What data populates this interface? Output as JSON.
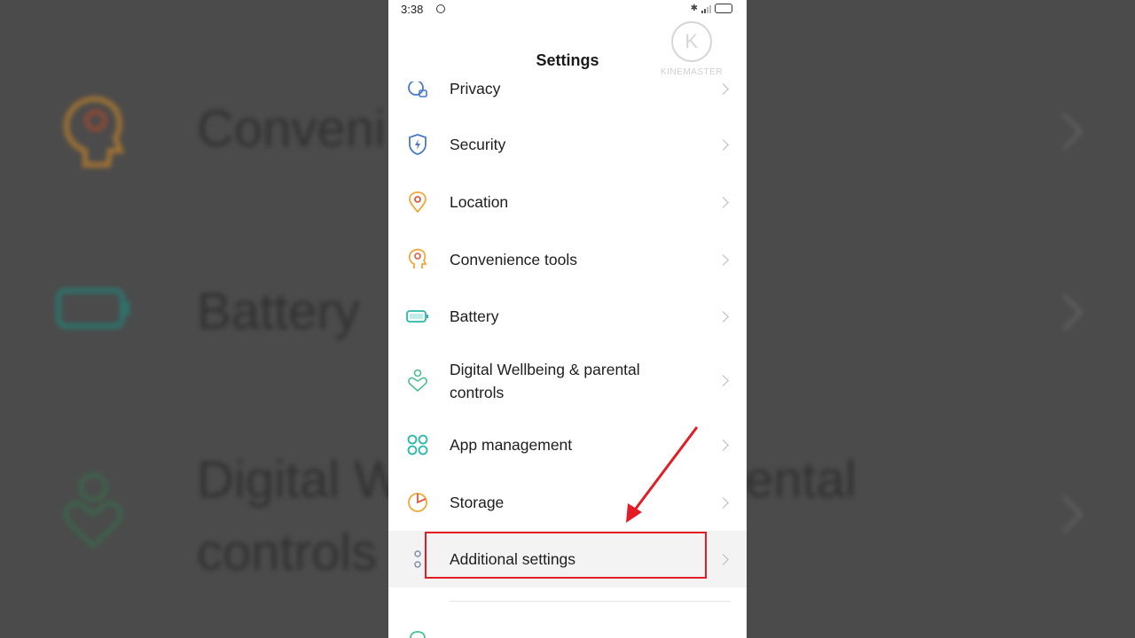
{
  "background": {
    "labels": [
      "Conveni",
      "Battery",
      "Digital W",
      "controls",
      "ental"
    ]
  },
  "status_bar": {
    "time": "3:38"
  },
  "header": {
    "title": "Settings"
  },
  "watermark": {
    "text": "KINEMASTER",
    "logo_letter": "K"
  },
  "settings": {
    "items": [
      {
        "label": "Privacy",
        "icon": "privacy-icon",
        "color": "#4a78c8"
      },
      {
        "label": "Security",
        "icon": "shield-icon",
        "color": "#4a78c8"
      },
      {
        "label": "Location",
        "icon": "location-pin-icon",
        "color": "#f0a838"
      },
      {
        "label": "Convenience tools",
        "icon": "head-gear-icon",
        "color": "#f0a838"
      },
      {
        "label": "Battery",
        "icon": "battery-icon",
        "color": "#29b8a7"
      },
      {
        "label": "Digital Wellbeing & parental controls",
        "label_line1": "Digital Wellbeing & parental",
        "label_line2": "controls",
        "icon": "wellbeing-icon",
        "color": "#4bbf8f"
      },
      {
        "label": "App management",
        "icon": "app-grid-icon",
        "color": "#29b8a7"
      },
      {
        "label": "Storage",
        "icon": "storage-pie-icon",
        "color": "#f0a838"
      },
      {
        "label": "Additional settings",
        "icon": "more-dots-icon",
        "color": "#8090a8"
      }
    ]
  },
  "annotation": {
    "highlight_color": "#e21d25"
  }
}
